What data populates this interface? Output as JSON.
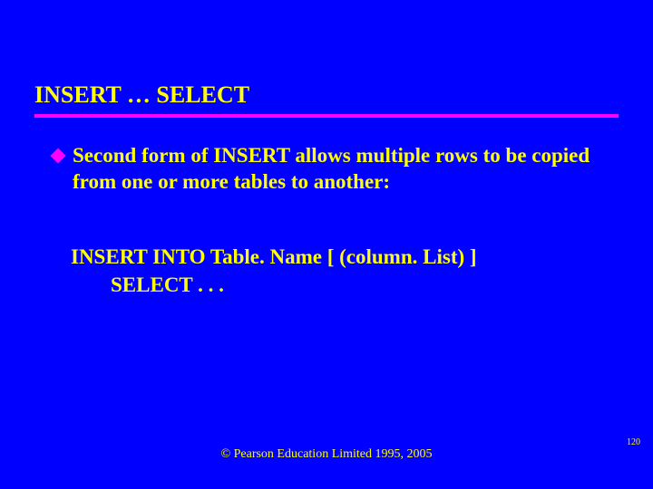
{
  "title": "INSERT … SELECT",
  "bullet": {
    "text": "Second form of INSERT allows multiple rows to be copied from one or more tables to another:"
  },
  "code": {
    "line1": "INSERT INTO Table. Name [ (column. List) ]",
    "line2": "SELECT . . ."
  },
  "footer": "© Pearson Education Limited 1995, 2005",
  "page_number": "120"
}
